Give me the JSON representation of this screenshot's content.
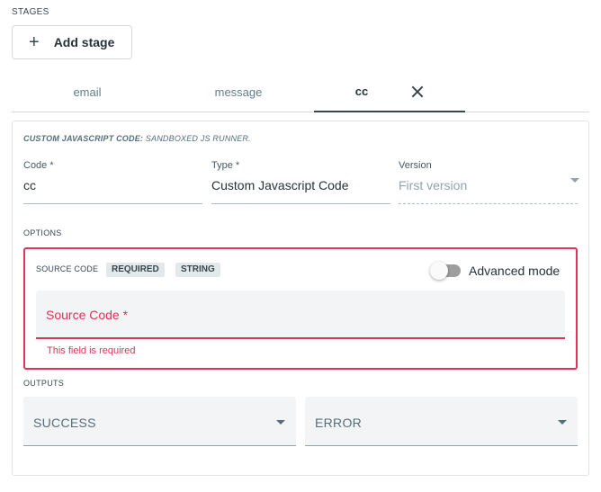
{
  "stages": {
    "label": "STAGES",
    "add_icon": "plus-icon",
    "add_label": "Add stage"
  },
  "tabs": [
    {
      "label": "email"
    },
    {
      "label": "message"
    },
    {
      "label": "cc",
      "active": true,
      "close_icon": "close-icon"
    }
  ],
  "panel": {
    "desc_bold": "CUSTOM JAVASCRIPT CODE:",
    "desc_rest": " SANDBOXED JS RUNNER.",
    "fields": {
      "code": {
        "label": "Code *",
        "value": "cc"
      },
      "type": {
        "label": "Type *",
        "value": "Custom Javascript Code"
      },
      "version": {
        "label": "Version",
        "value": "First version",
        "caret_icon": "chevron-down-icon"
      }
    },
    "options_label": "OPTIONS",
    "source": {
      "title": "SOURCE CODE",
      "badges": [
        "REQUIRED",
        "STRING"
      ],
      "toggle_label": "Advanced mode",
      "toggle_on": false,
      "placeholder": "Source Code *",
      "error": "This field is required",
      "error_color": "#e0335a"
    },
    "outputs_label": "OUTPUTS",
    "outputs": [
      {
        "value": "SUCCESS"
      },
      {
        "value": "ERROR"
      }
    ]
  }
}
